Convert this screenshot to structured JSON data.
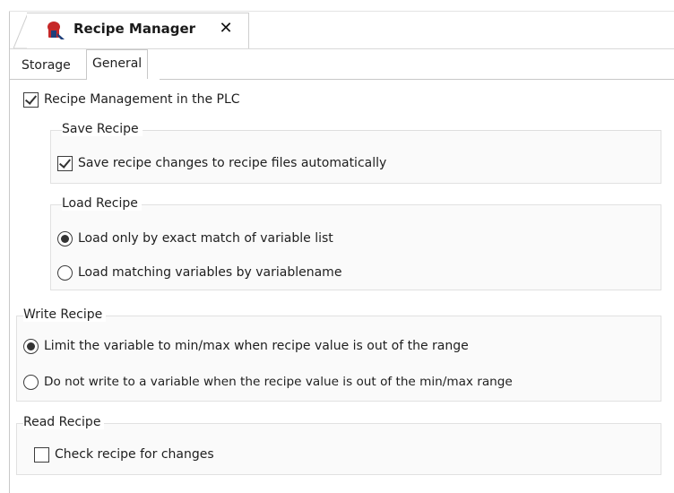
{
  "editor_tab": {
    "title": "Recipe Manager",
    "close_glyph": "✕",
    "icon": "recipe-manager-icon"
  },
  "subtabs": [
    {
      "label": "Storage",
      "active": false
    },
    {
      "label": "General",
      "active": true
    }
  ],
  "plc": {
    "label": "Recipe Management in the PLC",
    "checked": true
  },
  "save_recipe": {
    "title": "Save Recipe",
    "auto_save_label": "Save recipe changes to recipe files automatically",
    "auto_save_checked": true
  },
  "load_recipe": {
    "title": "Load Recipe",
    "options": [
      {
        "label": "Load only by exact match of variable list",
        "selected": true
      },
      {
        "label": "Load matching variables by variablename",
        "selected": false
      }
    ]
  },
  "write_recipe": {
    "title": "Write Recipe",
    "options": [
      {
        "label": "Limit the variable to min/max when recipe value is out of the range",
        "selected": true
      },
      {
        "label": "Do not write to a variable when the recipe value is out of the min/max range",
        "selected": false
      }
    ]
  },
  "read_recipe": {
    "title": "Read Recipe",
    "check_label": "Check recipe for changes",
    "check_checked": false
  },
  "colors": {
    "icon_red": "#c62828",
    "icon_blue": "#1f3f7a",
    "border": "#d0d0d0"
  }
}
